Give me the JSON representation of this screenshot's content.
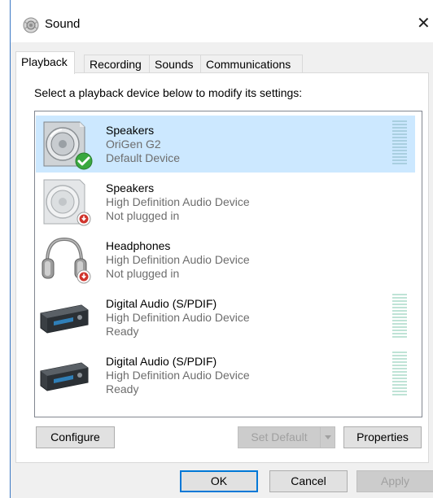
{
  "window": {
    "title": "Sound",
    "icon": "speaker-icon",
    "close_glyph": "✕"
  },
  "tabs": [
    {
      "label": "Playback",
      "active": true
    },
    {
      "label": "Recording",
      "active": false
    },
    {
      "label": "Sounds",
      "active": false
    },
    {
      "label": "Communications",
      "active": false
    }
  ],
  "instruction": "Select a playback device below to modify its settings:",
  "devices": [
    {
      "name": "Speakers",
      "driver": "OriGen G2",
      "status": "Default Device",
      "icon": "speaker-icon",
      "badge": "green-check-icon",
      "selected": true,
      "meter": true
    },
    {
      "name": "Speakers",
      "driver": "High Definition Audio Device",
      "status": "Not plugged in",
      "icon": "speaker-icon",
      "badge": "red-unplugged-icon",
      "selected": false,
      "meter": false
    },
    {
      "name": "Headphones",
      "driver": "High Definition Audio Device",
      "status": "Not plugged in",
      "icon": "headphones-icon",
      "badge": "red-unplugged-icon",
      "selected": false,
      "meter": false
    },
    {
      "name": "Digital Audio (S/PDIF)",
      "driver": "High Definition Audio Device",
      "status": "Ready",
      "icon": "digital-receiver-icon",
      "badge": "",
      "selected": false,
      "meter": true
    },
    {
      "name": "Digital Audio (S/PDIF)",
      "driver": "High Definition Audio Device",
      "status": "Ready",
      "icon": "digital-receiver-icon",
      "badge": "",
      "selected": false,
      "meter": true
    }
  ],
  "buttons": {
    "configure": "Configure",
    "set_default": "Set Default",
    "properties": "Properties",
    "ok": "OK",
    "cancel": "Cancel",
    "apply": "Apply"
  },
  "colors": {
    "selection": "#cce8ff",
    "accent": "#0078d7"
  }
}
